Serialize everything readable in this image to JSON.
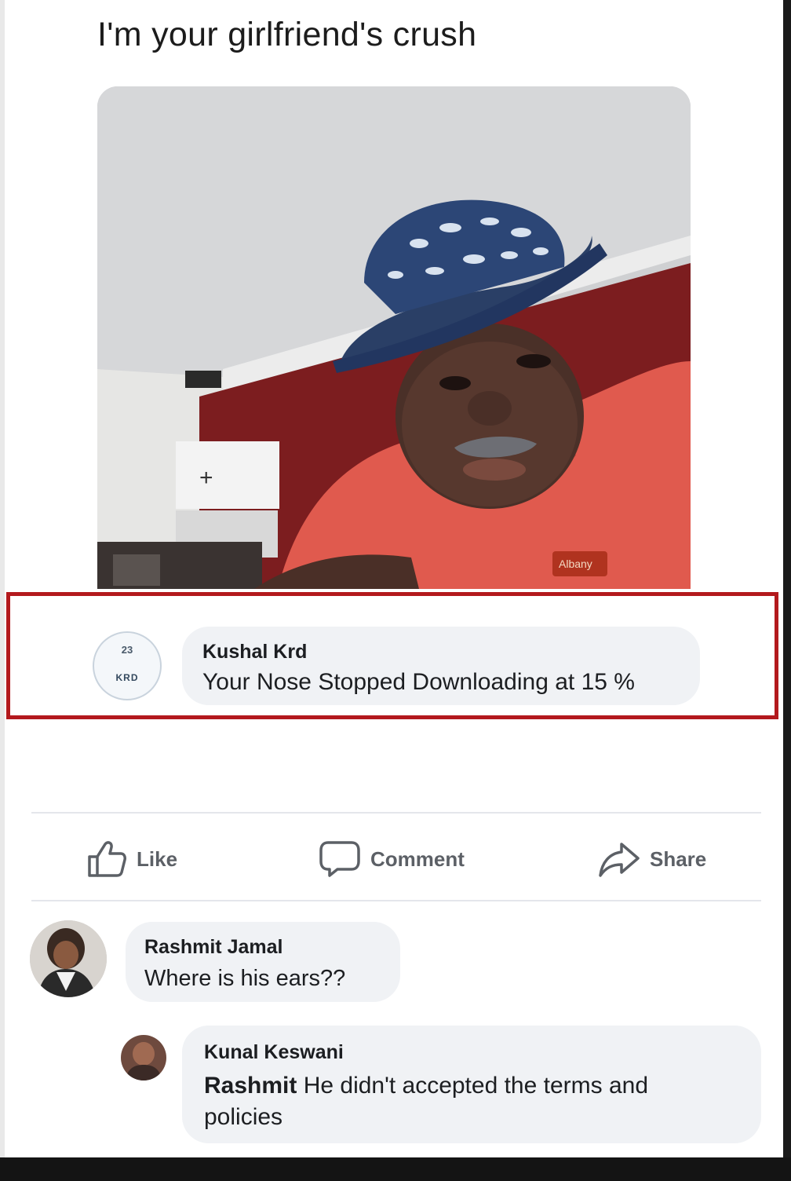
{
  "post": {
    "title": "I'm your girlfriend's crush"
  },
  "highlighted_comment": {
    "author": "Kushal Krd",
    "text": "Your Nose Stopped Downloading at 15 %",
    "avatar_text_top": "23",
    "avatar_text_bottom": "KRD"
  },
  "actions": {
    "like": "Like",
    "comment": "Comment",
    "share": "Share"
  },
  "comments": [
    {
      "author": "Rashmit Jamal",
      "text": "Where is his ears??"
    },
    {
      "author": "Kunal Keswani",
      "mention": "Rashmit",
      "text_line1": "He didn't accepted the terms and",
      "text_line2": "policies"
    }
  ],
  "colors": {
    "highlight_border": "#b3191d",
    "bubble_bg": "#f0f2f5",
    "action_text": "#5c6066"
  },
  "icons": [
    "thumbs-up-icon",
    "comment-icon",
    "share-icon"
  ]
}
